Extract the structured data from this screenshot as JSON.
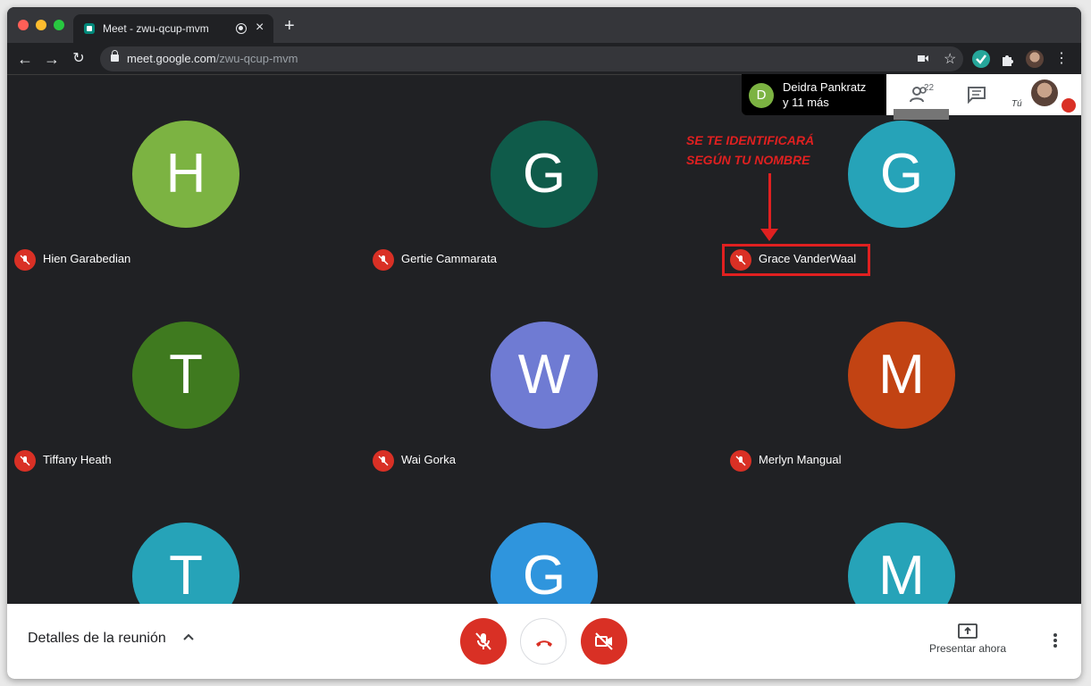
{
  "browser": {
    "tab_title": "Meet - zwu-qcup-mvm",
    "new_tab_label": "+",
    "url_host": "meet.google.com",
    "url_path": "/zwu-qcup-mvm"
  },
  "participants": [
    {
      "initial": "H",
      "name": "Hien Garabedian",
      "color": "#7cb342"
    },
    {
      "initial": "G",
      "name": "Gertie Cammarata",
      "color": "#0f5b4a"
    },
    {
      "initial": "G",
      "name": "Grace VanderWaal",
      "color": "#26a3b8"
    },
    {
      "initial": "T",
      "name": "Tiffany Heath",
      "color": "#3f7a1f"
    },
    {
      "initial": "W",
      "name": "Wai Gorka",
      "color": "#6f7bd3"
    },
    {
      "initial": "M",
      "name": "Merlyn Mangual",
      "color": "#c24313"
    },
    {
      "initial": "T",
      "name": "",
      "color": "#26a3b8"
    },
    {
      "initial": "G",
      "name": "",
      "color": "#2f95dd"
    },
    {
      "initial": "M",
      "name": "",
      "color": "#26a3b8"
    }
  ],
  "annotation": {
    "line1": "SE TE IDENTIFICARÁ",
    "line2": "SEGÚN TU NOMBRE"
  },
  "presenter": {
    "initial": "D",
    "line1": "Deidra Pankratz",
    "line2": "y 11 más"
  },
  "panel": {
    "people_count": "22",
    "self_label": "Tú"
  },
  "bottom": {
    "details_label": "Detalles de la reunión",
    "present_label": "Presentar ahora"
  }
}
